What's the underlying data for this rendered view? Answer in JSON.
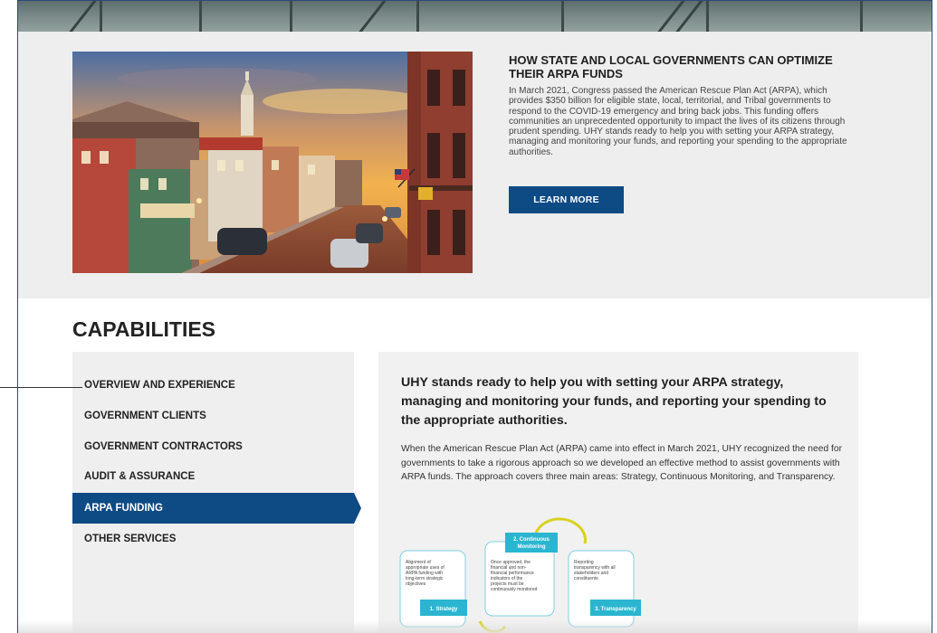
{
  "feature": {
    "title": "HOW STATE AND LOCAL GOVERNMENTS CAN OPTIMIZE THEIR ARPA FUNDS",
    "body": "In March 2021, Congress passed the American Rescue Plan Act (ARPA), which provides $350 billion for eligible state, local, territorial, and Tribal governments to respond to the COVID-19 emergency and bring back jobs. This funding offers communities an unprecedented opportunity to impact the lives of its citizens through prudent spending. UHY stands ready to help you with setting your ARPA strategy, managing and monitoring your funds, and reporting your spending to the appropriate authorities.",
    "cta_label": "LEARN MORE",
    "image_icon": "town-street-photo"
  },
  "capabilities": {
    "title": "CAPABILITIES",
    "menu": [
      {
        "label": "OVERVIEW AND EXPERIENCE",
        "active": false
      },
      {
        "label": "GOVERNMENT CLIENTS",
        "active": false
      },
      {
        "label": "GOVERNMENT CONTRACTORS",
        "active": false
      },
      {
        "label": "AUDIT & ASSURANCE",
        "active": false
      },
      {
        "label": "ARPA FUNDING",
        "active": true
      },
      {
        "label": "OTHER SERVICES",
        "active": false
      }
    ],
    "heading": "UHY stands ready to help you with setting your ARPA strategy, managing and monitoring your funds, and reporting your spending to the appropriate authorities.",
    "paragraph": "When the American Rescue Plan Act (ARPA) came into effect in March 2021, UHY recognized the need for governments to take a rigorous approach so we developed an effective method to assist governments with ARPA funds. The approach covers three main areas:  Strategy, Continuous Monitoring, and Transparency.",
    "diagram": {
      "strategy_label": "1. Strategy",
      "strategy_text": "Alignment of appropriate uses of ARPA funding with long-term strategic objectives",
      "monitoring_label_1": "2. Continuous",
      "monitoring_label_2": "Monitoring",
      "monitoring_text": "Once approved, the financial and non-financial performance indicators of the projects must be continuously monitored",
      "transparency_label": "3. Transparency",
      "transparency_text": "Reporting transparency with all stakeholders and constituents"
    }
  },
  "colors": {
    "brand_blue": "#0e4a84",
    "diagram_teal": "#2bb5d0",
    "diagram_yellow": "#d8d21e",
    "panel_gray": "#efefef"
  }
}
